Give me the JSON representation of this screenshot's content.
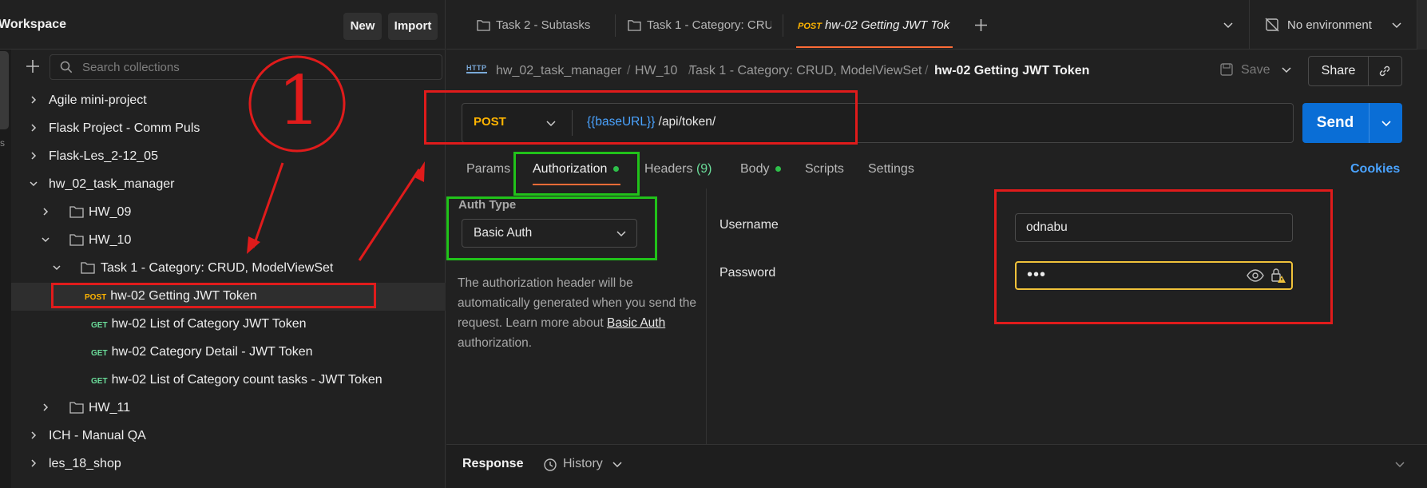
{
  "sidebar": {
    "workspace_title": "Workspace",
    "new_label": "New",
    "import_label": "Import",
    "rail_letter": "s",
    "search_placeholder": "Search collections",
    "items": [
      {
        "label": "Agile mini-project"
      },
      {
        "label": "Flask Project - Comm Puls"
      },
      {
        "label": "Flask-Les_2-12_05"
      },
      {
        "label": "hw_02_task_manager"
      },
      {
        "label": "HW_09"
      },
      {
        "label": "HW_10"
      },
      {
        "label": "Task 1 - Category: CRUD, ModelViewSet"
      },
      {
        "label": "hw-02 Getting JWT Token",
        "method": "POST"
      },
      {
        "label": "hw-02 List of Category JWT Token",
        "method": "GET"
      },
      {
        "label": "hw-02 Category Detail - JWT Token",
        "method": "GET"
      },
      {
        "label": "hw-02 List of Category count tasks - JWT Token",
        "method": "GET"
      },
      {
        "label": "HW_11"
      },
      {
        "label": "ICH - Manual QA"
      },
      {
        "label": "les_18_shop"
      }
    ]
  },
  "tabs": {
    "items": [
      {
        "label": "Task 2 - Subtasks"
      },
      {
        "label": "Task 1 - Category: CRUD"
      },
      {
        "method": "POST",
        "label": "hw-02 Getting JWT Tok"
      }
    ],
    "environment": "No environment"
  },
  "breadcrumb": {
    "icon_text": "HTTP",
    "parts": [
      "hw_02_task_manager",
      "HW_10",
      "Task 1 - Category: CRUD, ModelViewSet"
    ],
    "current": "hw-02 Getting JWT Token",
    "save_label": "Save",
    "share_label": "Share"
  },
  "request": {
    "method": "POST",
    "url_var": "{{baseURL}}",
    "url_path": " /api/token/",
    "send_label": "Send"
  },
  "req_tabs": {
    "params": "Params",
    "authorization": "Authorization",
    "headers": "Headers",
    "headers_count": "(9)",
    "body": "Body",
    "scripts": "Scripts",
    "settings": "Settings",
    "cookies": "Cookies"
  },
  "auth": {
    "type_label": "Auth Type",
    "type_value": "Basic Auth",
    "desc_1": "The authorization header will be automatically generated when you send the request. Learn more about ",
    "desc_link": "Basic Auth",
    "desc_2": " authorization.",
    "username_label": "Username",
    "username_value": "odnabu",
    "password_label": "Password",
    "password_mask": "•••"
  },
  "response": {
    "label": "Response",
    "history_label": "History"
  },
  "annotation": {
    "number": "1"
  },
  "colors": {
    "accent_orange": "#ff6c37",
    "send_blue": "#0a6ed6",
    "post_yellow": "#ffb400",
    "get_green": "#6bdd9a",
    "annotation_red": "#e01b1b",
    "annotation_green": "#21c21a"
  }
}
